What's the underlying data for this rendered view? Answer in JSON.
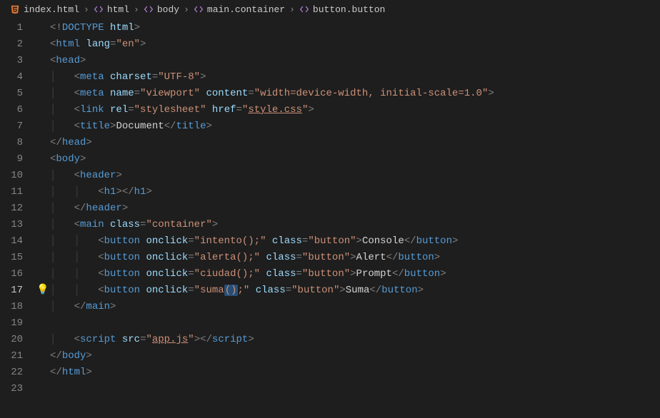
{
  "breadcrumb": {
    "file": "index.html",
    "path": [
      "html",
      "body",
      "main.container",
      "button.button"
    ]
  },
  "glyph": {
    "lightbulb_line": 17
  },
  "code": {
    "doctype": "DOCTYPE",
    "doctype_val": "html",
    "tags": {
      "html": "html",
      "head": "head",
      "meta": "meta",
      "link": "link",
      "title": "title",
      "body": "body",
      "header": "header",
      "h1": "h1",
      "main": "main",
      "button": "button",
      "script": "script"
    },
    "attrs": {
      "lang": "lang",
      "charset": "charset",
      "name": "name",
      "content": "content",
      "rel": "rel",
      "href": "href",
      "class": "class",
      "onclick": "onclick",
      "src": "src"
    },
    "vals": {
      "lang": "\"en\"",
      "charset": "\"UTF-8\"",
      "name_viewport": "\"viewport\"",
      "content_viewport": "\"width=device-width, initial-scale=1.0\"",
      "rel": "\"stylesheet\"",
      "href_style": "style.css",
      "class_container": "\"container\"",
      "class_button": "\"button\"",
      "src_app": "app.js",
      "onclick_intento": "\"intento();\"",
      "onclick_alerta": "\"alerta();\"",
      "onclick_ciudad": "\"ciudad();\"",
      "onclick_suma_pre": "\"suma",
      "onclick_suma_sel": "()",
      "onclick_suma_post": ";\"",
      "title_text": "Document",
      "btn_console": "Console",
      "btn_alert": "Alert",
      "btn_prompt": "Prompt",
      "btn_suma": "Suma"
    }
  },
  "line_numbers": [
    "1",
    "2",
    "3",
    "4",
    "5",
    "6",
    "7",
    "8",
    "9",
    "10",
    "11",
    "12",
    "13",
    "14",
    "15",
    "16",
    "17",
    "18",
    "19",
    "20",
    "21",
    "22",
    "23"
  ],
  "active_line": 17
}
